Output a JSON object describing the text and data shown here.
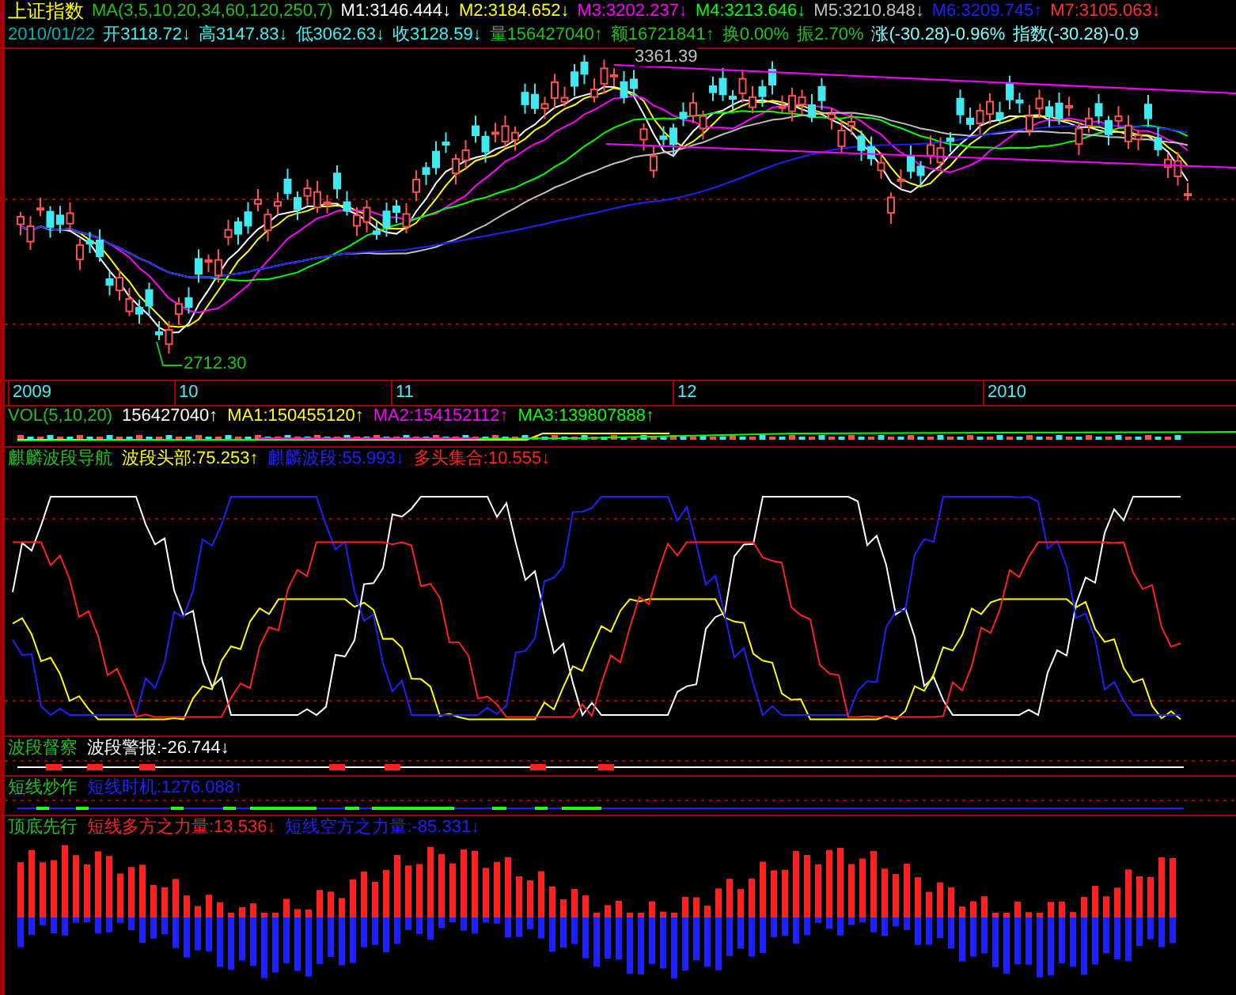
{
  "header": {
    "title": {
      "text": "上证指数",
      "color": "#ffff00"
    },
    "ma_legend": [
      {
        "text": "MA(3,5,10,20,34,60,120,250,7)",
        "color": "#20c020"
      },
      {
        "text": "M1:3146.444↓",
        "color": "#ffffff"
      },
      {
        "text": "M2:3184.652↓",
        "color": "#ffff00"
      },
      {
        "text": "M3:3202.237↓",
        "color": "#ff00ff"
      },
      {
        "text": "M4:3213.646↓",
        "color": "#00ff00"
      },
      {
        "text": "M5:3210.848↓",
        "color": "#c0c0c0"
      },
      {
        "text": "M6:3209.745↑",
        "color": "#2020ff"
      },
      {
        "text": "M7:3105.063↓",
        "color": "#ff3030"
      }
    ],
    "quote": [
      {
        "text": "2010/01/22",
        "color": "#00b0b0"
      },
      {
        "text": "开3118.72↓",
        "color": "#40f0f0"
      },
      {
        "text": "高3147.83↓",
        "color": "#40f0f0"
      },
      {
        "text": "低3062.63↓",
        "color": "#40f0f0"
      },
      {
        "text": "收3128.59↓",
        "color": "#40f0f0"
      },
      {
        "text": "量156427040↑",
        "color": "#20c020"
      },
      {
        "text": "额16721841↑",
        "color": "#20c020"
      },
      {
        "text": "换0.00%",
        "color": "#20c020"
      },
      {
        "text": "振2.70%",
        "color": "#20c020"
      },
      {
        "text": "涨(-30.28)-0.96%",
        "color": "#80ffff"
      },
      {
        "text": "指数(-30.28)-0.9",
        "color": "#80ffff"
      }
    ]
  },
  "price_chart": {
    "labels": [
      "3361.39",
      "2712.30"
    ]
  },
  "x_axis": {
    "labels": [
      "2009",
      "10",
      "11",
      "12",
      "2010"
    ]
  },
  "indicators": [
    {
      "kind": "volume",
      "legend": [
        {
          "text": "VOL(5,10,20)",
          "color": "#20c020"
        },
        {
          "text": "156427040↑",
          "color": "#ffffff"
        },
        {
          "text": "MA1:150455120↑",
          "color": "#ffff00"
        },
        {
          "text": "MA2:154152112↑",
          "color": "#ff00ff"
        },
        {
          "text": "MA3:139807888↑",
          "color": "#00ff00"
        }
      ]
    },
    {
      "kind": "bands",
      "legend": [
        {
          "text": "麒麟波段导航",
          "color": "#20c020"
        },
        {
          "text": "波段头部:75.253↑",
          "color": "#ffff00"
        },
        {
          "text": "麒麟波段:55.993↓",
          "color": "#2020ff"
        },
        {
          "text": "多头集合:10.555↓",
          "color": "#ff2020"
        }
      ]
    },
    {
      "kind": "alarm",
      "legend": [
        {
          "text": "波段督察",
          "color": "#20c020"
        },
        {
          "text": "波段警报:-26.744↓",
          "color": "#ffffff"
        }
      ]
    },
    {
      "kind": "timing",
      "legend": [
        {
          "text": "短线炒作",
          "color": "#20c020"
        },
        {
          "text": "短线时机:1276.088↑",
          "color": "#2020ff"
        }
      ]
    },
    {
      "kind": "force",
      "legend": [
        {
          "text": "顶底先行",
          "color": "#20c020"
        },
        {
          "text": "短线多方之力量:13.536↓",
          "color": "#ff2020"
        },
        {
          "text": "短线空方之力量:-85.331↓",
          "color": "#2020ff"
        }
      ]
    }
  ]
}
